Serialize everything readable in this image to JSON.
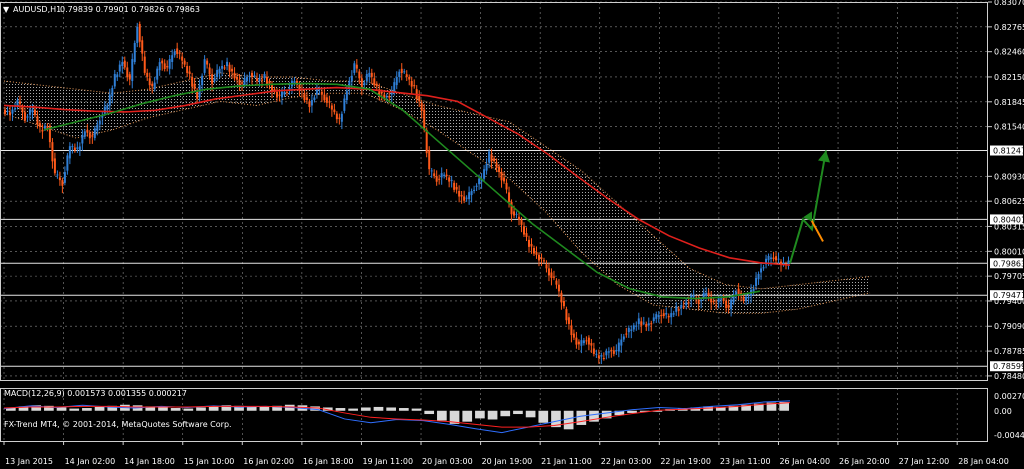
{
  "window": {
    "symbol_title": "AUDUSD,H1",
    "ohlc": "0.79839 0.79901 0.79826 0.79863",
    "macd_title": "MACD(12,26,9) 0.001573 0.001355 0.000217",
    "copyright": "FX-Trend MT4, © 2001-2014, MetaQuotes Software Corp."
  },
  "colors": {
    "background": "#000000",
    "grid": "#8a8a8a",
    "bull_candle": "#2f7fd6",
    "bear_candle": "#ff5a1a",
    "ma_fast": "#e0201c",
    "ma_slow": "#1f8a1f",
    "kumo": "#c9c9c9",
    "kumo_bear": "#e89a5a",
    "arrow_up": "#1f8a1f",
    "arrow_down": "#ff8c00",
    "macd_hist": "#d8d8d8",
    "macd_main": "#2f6fff",
    "macd_signal": "#ff2020"
  },
  "chart_data": {
    "type": "candlestick",
    "price_axis": {
      "range": [
        0.7843,
        0.8307
      ],
      "ticks": [
        "0.83070",
        "0.82765",
        "0.82460",
        "0.82150",
        "0.81845",
        "0.81540",
        "0.80930",
        "0.80625",
        "0.80315",
        "0.80010",
        "0.79705",
        "0.79400",
        "0.79090",
        "0.78785",
        "0.78480"
      ]
    },
    "horizontal_levels": [
      "0.81247",
      "0.80401",
      "0.79863",
      "0.79471",
      "0.78599"
    ],
    "current_price": "0.79863",
    "time_axis": [
      "13 Jan 2015",
      "14 Jan 02:00",
      "14 Jan 18:00",
      "15 Jan 10:00",
      "16 Jan 02:00",
      "16 Jan 18:00",
      "19 Jan 11:00",
      "20 Jan 03:00",
      "20 Jan 19:00",
      "21 Jan 11:00",
      "22 Jan 03:00",
      "22 Jan 19:00",
      "23 Jan 11:00",
      "26 Jan 04:00",
      "26 Jan 20:00",
      "27 Jan 12:00",
      "28 Jan 04:00"
    ],
    "close_path": [
      0.817,
      0.8185,
      0.8165,
      0.8175,
      0.815,
      0.8155,
      0.8095,
      0.8085,
      0.813,
      0.8125,
      0.815,
      0.814,
      0.8165,
      0.818,
      0.8215,
      0.8235,
      0.821,
      0.828,
      0.822,
      0.82,
      0.8235,
      0.8225,
      0.825,
      0.8235,
      0.8215,
      0.819,
      0.8235,
      0.821,
      0.8225,
      0.823,
      0.8215,
      0.8205,
      0.822,
      0.821,
      0.8215,
      0.82,
      0.819,
      0.82,
      0.821,
      0.8195,
      0.818,
      0.82,
      0.819,
      0.8175,
      0.816,
      0.82,
      0.823,
      0.8205,
      0.822,
      0.82,
      0.819,
      0.8195,
      0.8225,
      0.8215,
      0.82,
      0.8175,
      0.81,
      0.809,
      0.8095,
      0.8085,
      0.807,
      0.8065,
      0.808,
      0.809,
      0.812,
      0.8105,
      0.8085,
      0.805,
      0.804,
      0.8015,
      0.8,
      0.799,
      0.7975,
      0.796,
      0.793,
      0.79,
      0.7885,
      0.7895,
      0.7875,
      0.787,
      0.788,
      0.7878,
      0.79,
      0.7905,
      0.7915,
      0.791,
      0.7918,
      0.7925,
      0.792,
      0.793,
      0.7935,
      0.7945,
      0.794,
      0.795,
      0.7935,
      0.7945,
      0.793,
      0.7955,
      0.794,
      0.795,
      0.7975,
      0.799,
      0.7995,
      0.7985,
      0.7986
    ],
    "ma_fast": [
      0.818,
      0.8178,
      0.8175,
      0.8173,
      0.8172,
      0.8174,
      0.818,
      0.8188,
      0.8193,
      0.8198,
      0.82,
      0.8202,
      0.82,
      0.8196,
      0.8192,
      0.8185,
      0.8165,
      0.8145,
      0.812,
      0.8092,
      0.8065,
      0.804,
      0.802,
      0.8005,
      0.7993,
      0.7987,
      0.7984
    ],
    "ma_slow": [
      0.815,
      0.816,
      0.817,
      0.8182,
      0.8192,
      0.82,
      0.8204,
      0.8206,
      0.8207,
      0.8206,
      0.82,
      0.8175,
      0.814,
      0.8105,
      0.807,
      0.8035,
      0.8005,
      0.7975,
      0.7955,
      0.7945,
      0.7943,
      0.7945,
      0.7952
    ],
    "kumo_top": [
      0.821,
      0.8205,
      0.82,
      0.8195,
      0.82,
      0.821,
      0.822,
      0.8215,
      0.8215,
      0.821,
      0.821,
      0.8195,
      0.818,
      0.817,
      0.816,
      0.813,
      0.81,
      0.806,
      0.802,
      0.798,
      0.796,
      0.7955,
      0.796,
      0.7965,
      0.797
    ],
    "kumo_bottom": [
      0.817,
      0.8155,
      0.814,
      0.815,
      0.8165,
      0.8175,
      0.8185,
      0.818,
      0.819,
      0.8195,
      0.8195,
      0.8175,
      0.815,
      0.812,
      0.809,
      0.805,
      0.8,
      0.796,
      0.7935,
      0.793,
      0.7925,
      0.7925,
      0.793,
      0.794,
      0.795
    ],
    "projection": {
      "up_target": "0.81247",
      "pullback_level": "0.80401"
    },
    "macd": {
      "axis_ticks": [
        "0.002704",
        "0.00",
        "-0.004441"
      ],
      "range": [
        -0.004441,
        0.002704
      ],
      "histogram": [
        0.0006,
        0.0008,
        0.001,
        0.0009,
        0.0006,
        0.0004,
        0.0005,
        0.0007,
        0.0009,
        0.0011,
        0.001,
        0.0008,
        0.0006,
        0.0005,
        0.0004,
        0.0006,
        0.0008,
        0.001,
        0.0009,
        0.0008,
        0.0007,
        0.0009,
        0.0011,
        0.001,
        0.0008,
        0.0006,
        0.0005,
        0.0004,
        0.0006,
        0.0007,
        0.0006,
        0.0005,
        0.0004,
        -0.0006,
        -0.0018,
        -0.0024,
        -0.002,
        -0.0014,
        -0.0016,
        -0.001,
        -0.0006,
        -0.0012,
        -0.0022,
        -0.003,
        -0.0034,
        -0.0026,
        -0.002,
        -0.0014,
        -0.0008,
        -0.0004,
        -0.0002,
        0.0,
        0.0003,
        0.0005,
        0.0006,
        0.0008,
        0.0007,
        0.0009,
        0.0011,
        0.0013,
        0.0015,
        0.0016
      ],
      "main": [
        0.0004,
        0.0009,
        0.0006,
        0.001,
        0.0007,
        0.0005,
        0.0008,
        0.0006,
        0.0009,
        0.0007,
        0.0008,
        0.0006,
        0.0002,
        -0.0015,
        -0.0022,
        -0.0016,
        -0.0018,
        -0.0025,
        -0.0033,
        -0.004,
        -0.003,
        -0.002,
        -0.001,
        -0.0004,
        0.0002,
        0.0006,
        0.0004,
        0.0008,
        0.0011,
        0.0016,
        0.0018
      ],
      "signal": [
        0.0005,
        0.0007,
        0.0007,
        0.0008,
        0.0008,
        0.0007,
        0.0007,
        0.0007,
        0.0008,
        0.0008,
        0.0008,
        0.0007,
        0.0005,
        -0.0004,
        -0.0012,
        -0.0015,
        -0.0017,
        -0.002,
        -0.0025,
        -0.003,
        -0.003,
        -0.0027,
        -0.002,
        -0.0012,
        -0.0005,
        0.0001,
        0.0003,
        0.0005,
        0.0008,
        0.0012,
        0.0015
      ]
    }
  }
}
